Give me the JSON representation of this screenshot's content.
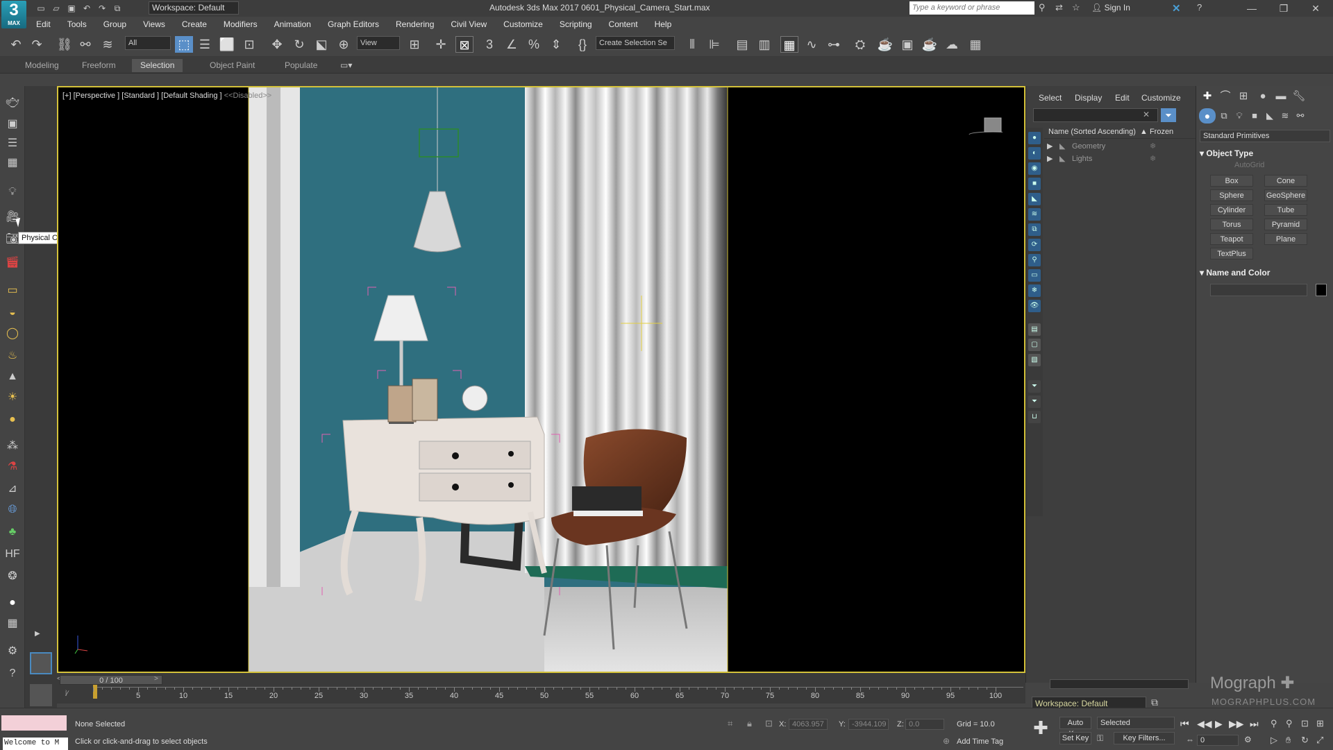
{
  "app": {
    "logo_text": "3",
    "logo_sub": "MAX",
    "workspace": "Workspace: Default",
    "title": "Autodesk 3ds Max 2017     0601_Physical_Camera_Start.max",
    "search_placeholder": "Type a keyword or phrase",
    "sign_in": "Sign In"
  },
  "menu": [
    "Edit",
    "Tools",
    "Group",
    "Views",
    "Create",
    "Modifiers",
    "Animation",
    "Graph Editors",
    "Rendering",
    "Civil View",
    "Customize",
    "Scripting",
    "Content",
    "Help"
  ],
  "toolbar": {
    "filter": "All",
    "ref_coord": "View",
    "selection_set": "Create Selection Se"
  },
  "ribbon_tabs": [
    "Modeling",
    "Freeform",
    "Selection",
    "Object Paint",
    "Populate"
  ],
  "ribbon_active": "Selection",
  "tooltip": "Physical Camera",
  "viewport": {
    "label_main": "[+] [Perspective ] [Standard ] [Default Shading ]",
    "label_disabled": "<<Disabled>>"
  },
  "scene_explorer": {
    "tabs": [
      "Select",
      "Display",
      "Edit",
      "Customize"
    ],
    "header_name": "Name (Sorted Ascending)",
    "header_frozen": "▲ Frozen",
    "rows": [
      "Geometry",
      "Lights"
    ],
    "workspace": "Workspace: Default"
  },
  "command_panel": {
    "category": "Standard Primitives",
    "object_type_title": "Object Type",
    "autogrid": "AutoGrid",
    "primitives": [
      "Box",
      "Cone",
      "Sphere",
      "GeoSphere",
      "Cylinder",
      "Tube",
      "Torus",
      "Pyramid",
      "Teapot",
      "Plane",
      "TextPlus"
    ],
    "name_color_title": "Name and Color",
    "swatch_color": "#000000"
  },
  "branding": {
    "name": "Mograph ✚",
    "url": "MOGRAPHPLUS.COM"
  },
  "timeline": {
    "frame_display": "0 / 100",
    "ticks": [
      "5",
      "10",
      "15",
      "20",
      "25",
      "30",
      "35",
      "40",
      "45",
      "50",
      "55",
      "60",
      "65",
      "70",
      "75",
      "80",
      "85",
      "90",
      "95",
      "100"
    ]
  },
  "status": {
    "maxscript_line1": "",
    "maxscript_line2": "Welcome to M",
    "selection": "None Selected",
    "prompt": "Click or click-and-drag to select objects",
    "x_label": "X:",
    "x_value": "4063.957",
    "y_label": "Y:",
    "y_value": "-3944.109",
    "z_label": "Z:",
    "z_value": "0.0",
    "grid": "Grid = 10.0",
    "add_time_tag": "Add Time Tag",
    "auto_key": "Auto Key",
    "set_key": "Set Key",
    "selected_dd": "Selected",
    "key_filters": "Key Filters...",
    "frame": "0"
  }
}
